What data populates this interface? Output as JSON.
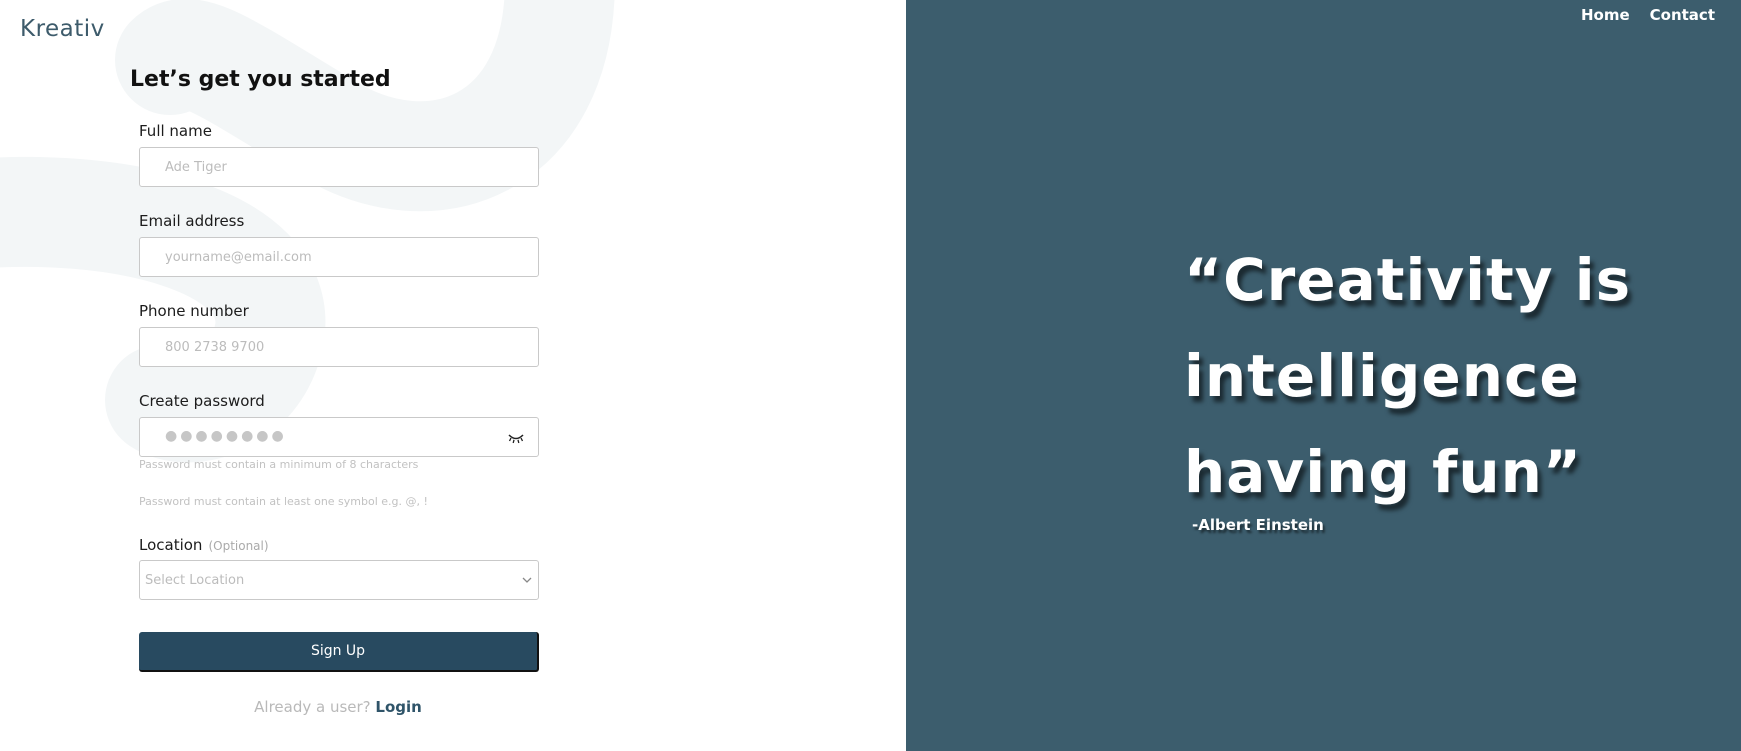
{
  "brand": {
    "logo": "Kreativ"
  },
  "nav": {
    "home": "Home",
    "contact": "Contact"
  },
  "form": {
    "title": "Let’s get you started",
    "full_name": {
      "label": "Full name",
      "placeholder": "Ade Tiger"
    },
    "email": {
      "label": "Email address",
      "placeholder": "yourname@email.com"
    },
    "phone": {
      "label": "Phone number",
      "placeholder": "800 2738 9700"
    },
    "password": {
      "label": "Create password",
      "value_mask": "●●●●●●●●",
      "hint_1": "Password must contain a minimum of 8 characters",
      "hint_2": "Password must contain at least one symbol e.g. @, !"
    },
    "location": {
      "label": "Location",
      "optional": "(Optional)",
      "selected": "Select Location"
    },
    "submit_label": "Sign Up",
    "already_text": "Already a user?",
    "login_label": "Login"
  },
  "quote": {
    "text": "“Creativity is intelligence having fun”",
    "author": "-Albert Einstein"
  },
  "colors": {
    "panel": "#3c5d6d",
    "button": "#284a60",
    "logo": "#3d5b6b"
  },
  "icons": {
    "password_toggle": "eye-closed-icon",
    "location_dropdown": "chevron-down-icon"
  }
}
